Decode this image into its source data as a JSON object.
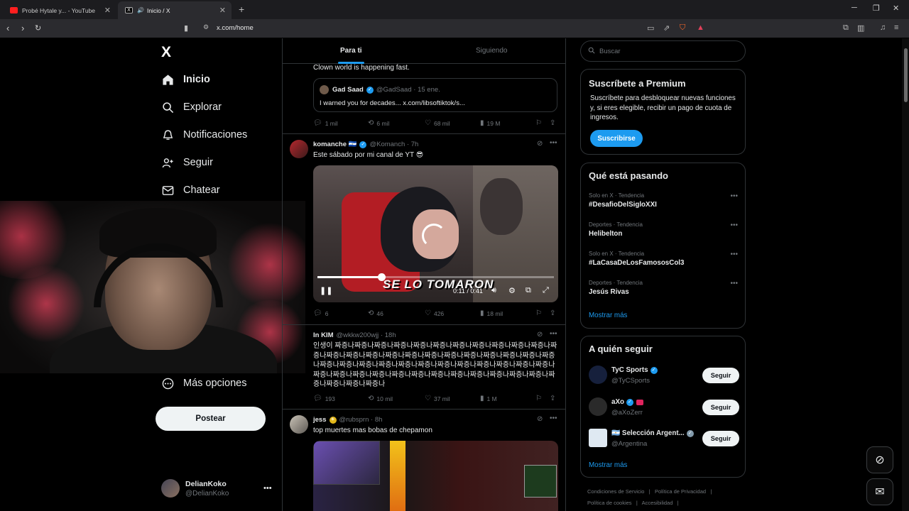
{
  "browser": {
    "tabs": [
      {
        "label": "Probé Hytale y... - YouTube",
        "active": false
      },
      {
        "label": "Inicio / X",
        "active": true
      }
    ],
    "url": "x.com/home"
  },
  "sidebar": {
    "logo": "X",
    "items": [
      {
        "label": "Inicio",
        "icon": "home-icon",
        "active": true
      },
      {
        "label": "Explorar",
        "icon": "search-icon"
      },
      {
        "label": "Notificaciones",
        "icon": "bell-icon"
      },
      {
        "label": "Seguir",
        "icon": "person-add-icon"
      },
      {
        "label": "Chatear",
        "icon": "mail-icon"
      },
      {
        "label": "Más opciones",
        "icon": "more-circle-icon"
      }
    ],
    "post_button": "Postear",
    "profile": {
      "name": "DelianKoko",
      "handle": "@DelianKoko"
    }
  },
  "feed": {
    "tabs": [
      {
        "label": "Para ti",
        "active": true
      },
      {
        "label": "Siguiendo",
        "active": false
      }
    ],
    "tweets": [
      {
        "text": "Clown world is happening fast.",
        "quote": {
          "name": "Gad Saad",
          "handle": "@GadSaad",
          "date": "15 ene.",
          "text": "I warned you for decades... x.com/libsoftiktok/s..."
        },
        "stats": {
          "replies": "1 mil",
          "reposts": "6 mil",
          "likes": "68 mil",
          "views": "19 M"
        }
      },
      {
        "name": "komanche 🇸🇻",
        "handle": "@Komanch",
        "time": "7h",
        "text": "Este sábado por mi canal de YT 😎",
        "video": {
          "caption": "SE LO TOMARON",
          "time": "0:11 / 0:41",
          "progress": 0.27
        },
        "stats": {
          "replies": "6",
          "reposts": "46",
          "likes": "426",
          "views": "18 mil"
        }
      },
      {
        "name": "In KIM",
        "handle": "@wkkw200wjj",
        "time": "18h",
        "text": "인생이 짜증나짜증나짜증나짜증나짜증나짜증나짜증나짜증나짜증나짜증나짜증나짜증나짜증나짜증나짜증나짜증나짜증나짜증나짜증나짜증나짜증나짜증나짜증나짜증나짜증나짜증나짜증나짜증나짜증나짜증나짜증나짜증나짜증나짜증나짜증나짜증나짜증나짜증나짜증나짜증나짜증나짜증나짜증나짜증나짜증나짜증나짜증나짜증나짜증나짜증나짜증나짜증나",
        "stats": {
          "replies": "193",
          "reposts": "10 mil",
          "likes": "37 mil",
          "views": "1 M"
        }
      },
      {
        "name": "jess",
        "handle": "@rubsprn",
        "time": "8h",
        "text": "top muertes mas bobas de chepamon"
      }
    ]
  },
  "right": {
    "search_placeholder": "Buscar",
    "premium": {
      "title": "Suscríbete a Premium",
      "desc": "Suscríbete para desbloquear nuevas funciones y, si eres elegible, recibir un pago de cuota de ingresos.",
      "button": "Suscribirse"
    },
    "trends": {
      "title": "Qué está pasando",
      "items": [
        {
          "context": "Solo en X · Tendencia",
          "name": "#DesafioDelSigloXXI"
        },
        {
          "context": "Deportes · Tendencia",
          "name": "Helibelton"
        },
        {
          "context": "Solo en X · Tendencia",
          "name": "#LaCasaDeLosFamososCol3"
        },
        {
          "context": "Deportes · Tendencia",
          "name": "Jesús Rivas"
        }
      ],
      "show_more": "Mostrar más"
    },
    "who_to_follow": {
      "title": "A quién seguir",
      "items": [
        {
          "name": "TyC Sports",
          "handle": "@TyCSports",
          "button": "Seguir"
        },
        {
          "name": "aXo",
          "handle": "@aXoZerr",
          "button": "Seguir"
        },
        {
          "name": "🇦🇷 Selección Argent...",
          "handle": "@Argentina",
          "button": "Seguir"
        }
      ],
      "show_more": "Mostrar más"
    },
    "footer": {
      "line1": [
        "Condiciones de Servicio",
        "|",
        "Política de Privacidad",
        "|"
      ],
      "line2": [
        "Política de cookies",
        "|",
        "Accesibilidad",
        "|"
      ]
    }
  }
}
